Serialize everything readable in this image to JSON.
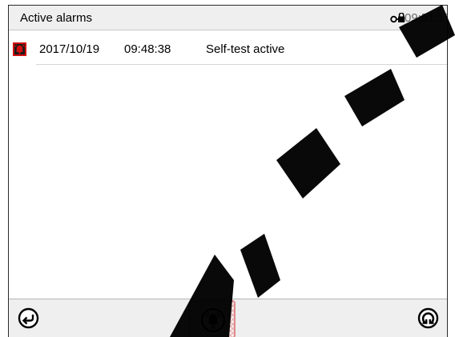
{
  "header": {
    "title": "Active alarms",
    "lock_icon": "lock-key-icon",
    "time": "09:51:17"
  },
  "alarms": [
    {
      "icon": "alarm-bell-icon",
      "date": "2017/10/19",
      "time": "09:48:38",
      "message": "Self-test active"
    }
  ],
  "footer": {
    "back_icon": "back-arrow-icon",
    "mute_icon": "alarm-mute-icon",
    "refresh_icon": "refresh-icon"
  },
  "watermark": {
    "color": "#000000"
  },
  "colors": {
    "alarm_red": "#d10f0f",
    "header_bg": "#efefef",
    "highlight_border": "#e08a8a"
  }
}
